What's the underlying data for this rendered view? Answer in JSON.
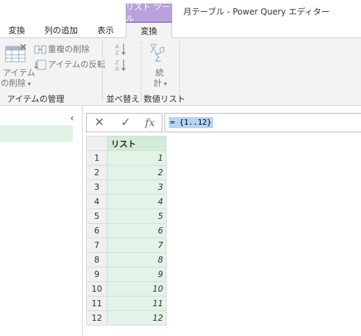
{
  "window": {
    "context_tab": "リスト ツール",
    "title": "月テーブル - Power Query エディター"
  },
  "ribbon_tabs": [
    "変換",
    "列の追加",
    "表示",
    "変換"
  ],
  "ribbon": {
    "group_items": {
      "remove_items_line1": "アイテム",
      "remove_items_line2": "の削除",
      "remove_duplicates": "重複の削除",
      "reverse_items": "アイテムの反転",
      "group_label": "アイテムの管理"
    },
    "group_sort": {
      "group_label": "並べ替え"
    },
    "group_numeric": {
      "symbol": "Σ",
      "stats_line1": "統",
      "stats_line2": "計",
      "group_label": "数値リスト"
    }
  },
  "formula_bar": {
    "formula": "= {1..12}"
  },
  "table": {
    "column_header": "リスト",
    "rows": [
      {
        "n": "1",
        "v": "1"
      },
      {
        "n": "2",
        "v": "2"
      },
      {
        "n": "3",
        "v": "3"
      },
      {
        "n": "4",
        "v": "4"
      },
      {
        "n": "5",
        "v": "5"
      },
      {
        "n": "6",
        "v": "6"
      },
      {
        "n": "7",
        "v": "7"
      },
      {
        "n": "8",
        "v": "8"
      },
      {
        "n": "9",
        "v": "9"
      },
      {
        "n": "10",
        "v": "10"
      },
      {
        "n": "11",
        "v": "11"
      },
      {
        "n": "12",
        "v": "12"
      }
    ]
  },
  "colors": {
    "context_tab": "#b8a2dc",
    "table_cells": "#e2f3e7",
    "formula_highlight": "#b6d5f2"
  }
}
